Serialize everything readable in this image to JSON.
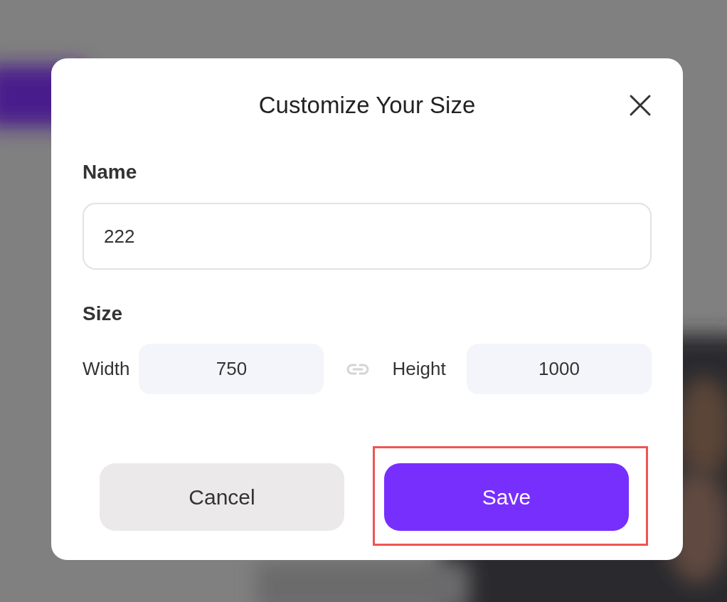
{
  "dialog": {
    "title": "Customize Your Size",
    "name": {
      "label": "Name",
      "value": "222"
    },
    "size": {
      "label": "Size",
      "width_label": "Width",
      "width_value": "750",
      "height_label": "Height",
      "height_value": "1000",
      "linked": false
    },
    "buttons": [
      {
        "label": "Cancel",
        "kind": "secondary",
        "highlighted": false
      },
      {
        "label": "Save",
        "kind": "primary",
        "highlighted": true
      }
    ]
  }
}
